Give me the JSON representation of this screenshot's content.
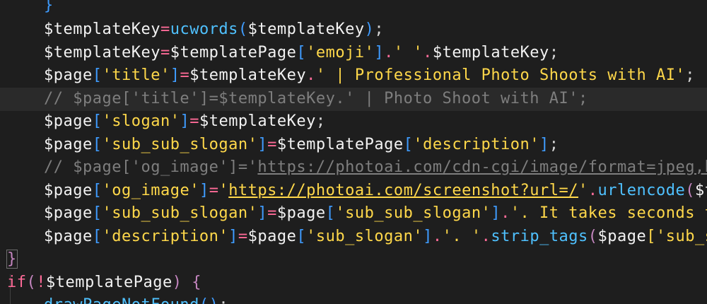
{
  "editor": {
    "language": "php",
    "lines": [
      {
        "brace": "}"
      },
      {
        "v1": "$templateKey",
        "eq": "=",
        "fn": "ucwords",
        "op": "(",
        "v2": "$templateKey",
        "cl": ")",
        "semi": ";"
      },
      {
        "v1": "$templateKey",
        "eq": "=",
        "v2": "$templatePage",
        "lb": "[",
        "key": "'emoji'",
        "rb": "]",
        "dot": ".",
        "sp": "' '",
        "dot2": ".",
        "v3": "$templateKey",
        "semi": ";"
      },
      {
        "v1": "$page",
        "lb": "[",
        "key": "'title'",
        "rb": "]",
        "eq": "=",
        "v2": "$templateKey",
        "dot": ".",
        "str": "' | Professional Photo Shoots with AI'",
        "semi": ";"
      },
      {
        "comment": "// $page['title']=$templateKey.' | Photo Shoot with AI';"
      },
      {
        "v1": "$page",
        "lb": "[",
        "key": "'slogan'",
        "rb": "]",
        "eq": "=",
        "v2": "$templateKey",
        "semi": ";"
      },
      {
        "v1": "$page",
        "lb": "[",
        "key": "'sub_sub_slogan'",
        "rb": "]",
        "eq": "=",
        "v2": "$templatePage",
        "lb2": "[",
        "key2": "'description'",
        "rb2": "]",
        "semi": ";"
      },
      {
        "comment_pre": "// $page['og_image']='",
        "comment_url": "https://photoai.com/cdn-cgi/image/format=jpeg,back"
      },
      {
        "v1": "$page",
        "lb": "[",
        "key": "'og_image'",
        "rb": "]",
        "eq": "=",
        "q": "'",
        "url": "https://photoai.com/screenshot?url=/",
        "q2": "'",
        "dot": ".",
        "fn": "urlencode",
        "op": "(",
        "v2": "$temp"
      },
      {
        "v1": "$page",
        "lb": "[",
        "key": "'sub_sub_slogan'",
        "rb": "]",
        "eq": "=",
        "v2": "$page",
        "lb2": "[",
        "key2": "'sub_sub_slogan'",
        "rb2": "]",
        "dot": ".",
        "str": "'. It takes seconds to t"
      },
      {
        "v1": "$page",
        "lb": "[",
        "key": "'description'",
        "rb": "]",
        "eq": "=",
        "v2": "$page",
        "lb2": "[",
        "key2": "'sub_slogan'",
        "rb2": "]",
        "dot": ".",
        "sp": "'. '",
        "dot2": ".",
        "fn": "strip_tags",
        "op": "(",
        "v3": "$page",
        "lb3": "[",
        "key3": "'sub_sub_"
      },
      {
        "brace": "}"
      },
      {
        "kw": "if",
        "op": "(",
        "not": "!",
        "v1": "$templatePage",
        "cl": ")",
        "sp": " ",
        "ob": "{"
      },
      {
        "fn": "drawPageNotFound",
        "op": "(",
        "cl": ")",
        "semi": ";"
      }
    ]
  }
}
